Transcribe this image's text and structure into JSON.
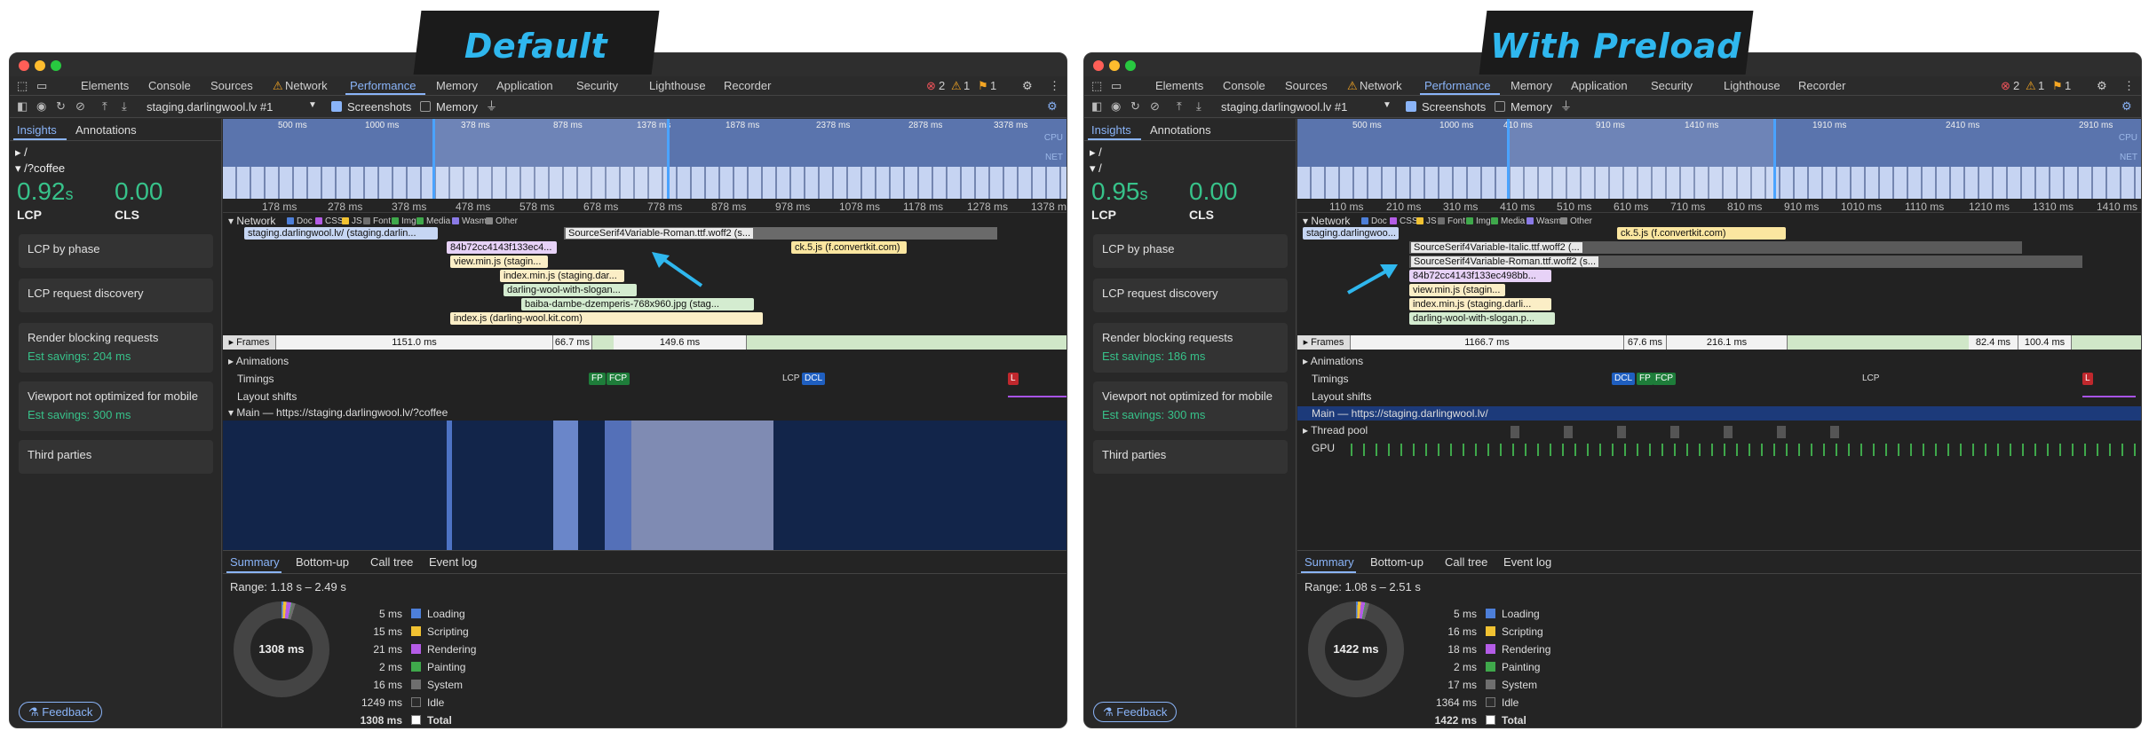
{
  "banners": {
    "left": "Default",
    "right": "With Preload"
  },
  "devtools_tabs": [
    "Elements",
    "Console",
    "Sources",
    "Network",
    "Performance",
    "Memory",
    "Application",
    "Security",
    "Lighthouse",
    "Recorder"
  ],
  "badges": {
    "errors": "2",
    "warnings": "1",
    "issues": "1"
  },
  "toolbar": {
    "target": "staging.darlingwool.lv #1",
    "screenshots": "Screenshots",
    "memory": "Memory"
  },
  "sidebar_tabs": {
    "insights": "Insights",
    "annotations": "Annotations"
  },
  "insights": {
    "lcp_label": "LCP",
    "cls_label": "CLS",
    "lcp_phase": "LCP by phase",
    "lcp_discovery": "LCP request discovery",
    "render_blocking": "Render blocking requests",
    "viewport": "Viewport not optimized for mobile",
    "third": "Third parties",
    "viewport_savings": "Est savings: 300 ms"
  },
  "feedback": "Feedback",
  "legend": {
    "doc": "Doc",
    "css": "CSS",
    "js": "JS",
    "font": "Font",
    "img": "Img",
    "media": "Media",
    "wasm": "Wasm",
    "other": "Other"
  },
  "track_labels": {
    "network": "Network",
    "frames": "Frames",
    "animations": "Animations",
    "timings": "Timings",
    "layout": "Layout shifts",
    "thread_pool": "Thread pool",
    "gpu": "GPU"
  },
  "cpu": "CPU",
  "net": "NET",
  "timing_names": {
    "fp": "FP",
    "fcp": "FCP",
    "lcp": "LCP",
    "dcl": "DCL",
    "l": "L"
  },
  "bottom_tabs": [
    "Summary",
    "Bottom-up",
    "Call tree",
    "Event log"
  ],
  "summary_labels": [
    "Loading",
    "Scripting",
    "Rendering",
    "Painting",
    "System",
    "Idle",
    "Total"
  ],
  "colors": {
    "loading": "#4d7fd9",
    "scripting": "#f1c232",
    "rendering": "#b45ce6",
    "painting": "#3fa84b",
    "system": "#6e6e6e",
    "idle": "#2b2b2b",
    "accent": "#8ab4f8",
    "good": "#37c28a",
    "banner": "#2fb7ee"
  },
  "left": {
    "tree_root": "/",
    "tree_page": "/?coffee",
    "lcp": "0.92",
    "lcp_unit": "s",
    "cls": "0.00",
    "render_savings": "Est savings: 204 ms",
    "overview_ticks": [
      "500 ms",
      "1000 ms",
      "378 ms",
      "878 ms",
      "1378 ms",
      "1878 ms",
      "2378 ms",
      "2878 ms",
      "3378 ms"
    ],
    "ruler": [
      "178 ms",
      "278 ms",
      "378 ms",
      "478 ms",
      "578 ms",
      "678 ms",
      "778 ms",
      "878 ms",
      "978 ms",
      "1078 ms",
      "1178 ms",
      "1278 ms",
      "1378 ms"
    ],
    "requests": [
      "staging.darlingwool.lv/ (staging.darlin...",
      "SourceSerif4Variable-Roman.ttf.woff2 (s...",
      "84b72cc4143f133ec4...",
      "ck.5.js (f.convertkit.com)",
      "view.min.js (stagin...",
      "index.min.js (staging.dar...",
      "darling-wool-with-slogan...",
      "baiba-dambe-dzemperis-768x960.jpg (stag...",
      "index.js (darling-wool.kit.com)"
    ],
    "frames": [
      "1151.0 ms",
      "66.7 ms",
      "149.6 ms"
    ],
    "main_track": "Main — https://staging.darlingwool.lv/?coffee",
    "range": "Range: 1.18 s – 2.49 s",
    "donut_total": "1308 ms",
    "summary_values": [
      "5 ms",
      "15 ms",
      "21 ms",
      "2 ms",
      "16 ms",
      "1249 ms",
      "1308 ms"
    ]
  },
  "right": {
    "tree_root": "/",
    "tree_page": "/",
    "lcp": "0.95",
    "lcp_unit": "s",
    "cls": "0.00",
    "render_savings": "Est savings: 186 ms",
    "overview_ticks": [
      "500 ms",
      "1000 ms",
      "410 ms",
      "910 ms",
      "1410 ms",
      "1910 ms",
      "2410 ms",
      "2910 ms"
    ],
    "ruler": [
      "110 ms",
      "210 ms",
      "310 ms",
      "410 ms",
      "510 ms",
      "610 ms",
      "710 ms",
      "810 ms",
      "910 ms",
      "1010 ms",
      "1110 ms",
      "1210 ms",
      "1310 ms",
      "1410 ms"
    ],
    "requests": [
      "staging.darlingwoo...",
      "ck.5.js (f.convertkit.com)",
      "SourceSerif4Variable-Italic.ttf.woff2 (...",
      "SourceSerif4Variable-Roman.ttf.woff2 (s...",
      "84b72cc4143f133ec498bb...",
      "view.min.js (stagin...",
      "index.min.js (staging.darli...",
      "darling-wool-with-slogan.p..."
    ],
    "frames": [
      "1166.7 ms",
      "67.6 ms",
      "216.1 ms",
      "82.4 ms",
      "100.4 ms"
    ],
    "main_track": "Main — https://staging.darlingwool.lv/",
    "range": "Range: 1.08 s – 2.51 s",
    "donut_total": "1422 ms",
    "summary_values": [
      "5 ms",
      "16 ms",
      "18 ms",
      "2 ms",
      "17 ms",
      "1364 ms",
      "1422 ms"
    ]
  }
}
